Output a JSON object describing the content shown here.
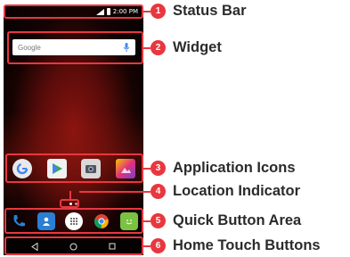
{
  "status_bar": {
    "time": "2:00 PM"
  },
  "widget": {
    "logo_text": "Google"
  },
  "labels": [
    {
      "number": "1",
      "text": "Status Bar"
    },
    {
      "number": "2",
      "text": "Widget"
    },
    {
      "number": "3",
      "text": "Application Icons"
    },
    {
      "number": "4",
      "text": "Location Indicator"
    },
    {
      "number": "5",
      "text": "Quick Button Area"
    },
    {
      "number": "6",
      "text": "Home Touch Buttons"
    }
  ],
  "colors": {
    "callout": "#e8373f",
    "label_text": "#2b2b2b",
    "number_badge_text": "#ffffff"
  },
  "application_icons": [
    "google-app-icon",
    "play-store-icon",
    "camera-icon",
    "gallery-icon"
  ],
  "quick_buttons": [
    "phone-icon",
    "contacts-icon",
    "apps-drawer-icon",
    "chrome-icon",
    "messaging-icon"
  ],
  "home_buttons": [
    "back-icon",
    "home-icon",
    "recents-icon"
  ]
}
